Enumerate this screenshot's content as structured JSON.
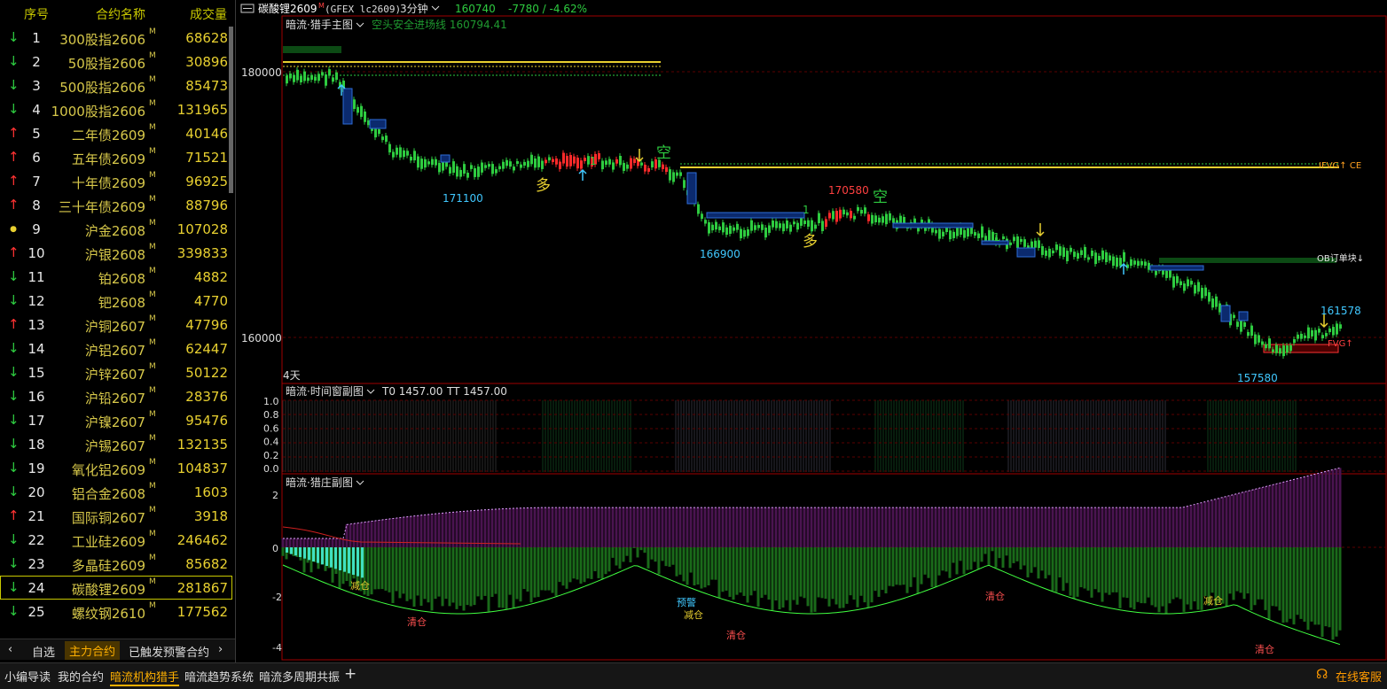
{
  "list": {
    "headers": {
      "index": "序号",
      "name": "合约名称",
      "volume": "成交量"
    },
    "rows": [
      {
        "dir": "down",
        "index": "1",
        "name": "300股指2606",
        "volume": "68628"
      },
      {
        "dir": "down",
        "index": "2",
        "name": "50股指2606",
        "volume": "30896"
      },
      {
        "dir": "down",
        "index": "3",
        "name": "500股指2606",
        "volume": "85473"
      },
      {
        "dir": "down",
        "index": "4",
        "name": "1000股指2606",
        "volume": "131965"
      },
      {
        "dir": "up",
        "index": "5",
        "name": "二年债2609",
        "volume": "40146"
      },
      {
        "dir": "up",
        "index": "6",
        "name": "五年债2609",
        "volume": "71521"
      },
      {
        "dir": "up",
        "index": "7",
        "name": "十年债2609",
        "volume": "96925"
      },
      {
        "dir": "up",
        "index": "8",
        "name": "三十年债2609",
        "volume": "88796"
      },
      {
        "dir": "flat",
        "index": "9",
        "name": "沪金2608",
        "volume": "107028"
      },
      {
        "dir": "up",
        "index": "10",
        "name": "沪银2608",
        "volume": "339833"
      },
      {
        "dir": "down",
        "index": "11",
        "name": "铂2608",
        "volume": "4882"
      },
      {
        "dir": "down",
        "index": "12",
        "name": "钯2608",
        "volume": "4770"
      },
      {
        "dir": "up",
        "index": "13",
        "name": "沪铜2607",
        "volume": "47796"
      },
      {
        "dir": "down",
        "index": "14",
        "name": "沪铝2607",
        "volume": "62447"
      },
      {
        "dir": "down",
        "index": "15",
        "name": "沪锌2607",
        "volume": "50122"
      },
      {
        "dir": "down",
        "index": "16",
        "name": "沪铅2607",
        "volume": "28376"
      },
      {
        "dir": "down",
        "index": "17",
        "name": "沪镍2607",
        "volume": "95476"
      },
      {
        "dir": "down",
        "index": "18",
        "name": "沪锡2607",
        "volume": "132135"
      },
      {
        "dir": "down",
        "index": "19",
        "name": "氧化铝2609",
        "volume": "104837"
      },
      {
        "dir": "down",
        "index": "20",
        "name": "铝合金2608",
        "volume": "1603"
      },
      {
        "dir": "up",
        "index": "21",
        "name": "国际铜2607",
        "volume": "3918"
      },
      {
        "dir": "down",
        "index": "22",
        "name": "工业硅2609",
        "volume": "246462"
      },
      {
        "dir": "down",
        "index": "23",
        "name": "多晶硅2609",
        "volume": "85682"
      },
      {
        "dir": "down",
        "index": "24",
        "name": "碳酸锂2609",
        "volume": "281867",
        "selected": true
      },
      {
        "dir": "down",
        "index": "25",
        "name": "螺纹钢2610",
        "volume": "177562"
      }
    ],
    "main_sup": "M",
    "up_arrow": "↑",
    "down_arrow": "↓",
    "flat_dot": "●"
  },
  "left_tabs": {
    "prev": "‹",
    "tab1": "自选",
    "tab2": "主力合约",
    "tab3": "已触发预警合约",
    "next": "›"
  },
  "bottom_tabs": [
    "小编导读",
    "我的合约",
    "暗流机构猎手",
    "暗流趋势系统",
    "暗流多周期共振"
  ],
  "bottom_active": "暗流机构猎手",
  "add_tab": "+",
  "service": "在线客服",
  "header": {
    "symbol": "碳酸锂2609",
    "sup": "M",
    "code": "(GFEX lc2609)",
    "period": "3分钟",
    "price": "160740",
    "change": "-7780 / -4.62%"
  },
  "main_panel": {
    "title": "暗流·猎手主图",
    "subtitle": "空头安全进场线 160794.41",
    "y_labels": [
      "180000",
      "160000"
    ],
    "days_label": "4天",
    "price_labels": [
      "171100",
      "166900",
      "170580",
      "157580",
      "161578"
    ],
    "level_labels": [
      "IFVG↑ CE",
      "OB订单块↓",
      "FVG↑"
    ],
    "signals": {
      "long": "多",
      "short": "空",
      "one": "1"
    }
  },
  "time_panel": {
    "title": "暗流·时间窗副图",
    "t0": "T0 1457.00",
    "tt": "TT 1457.00",
    "y_labels": [
      "1.0",
      "0.8",
      "0.6",
      "0.4",
      "0.2",
      "0.0"
    ]
  },
  "hunter_panel": {
    "title": "暗流·猎庄副图",
    "y_labels": [
      "2",
      "0",
      "-2",
      "-4"
    ],
    "marks": {
      "reduce": "减仓",
      "clear": "清仓",
      "warn": "预警"
    }
  },
  "colors": {
    "up": "#ff3333",
    "down": "#2ecc40",
    "accent": "#ffb000",
    "border": "#b00000"
  }
}
